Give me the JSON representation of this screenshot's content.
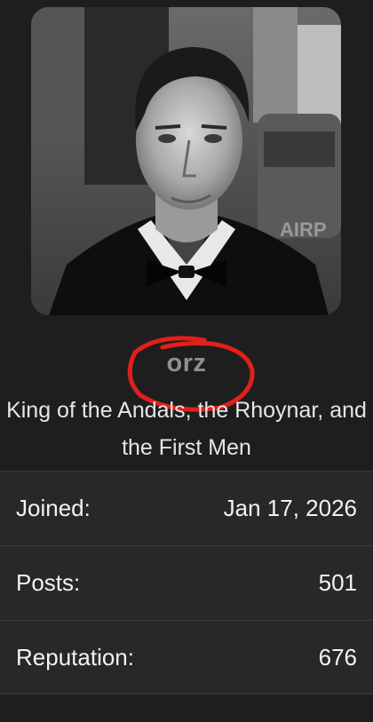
{
  "profile": {
    "username": "orz",
    "user_title": "King of the Andals, the Rhoynar, and the First Men",
    "avatar_alt": "avatar"
  },
  "stats": [
    {
      "label": "Joined:",
      "value": "Jan 17, 2026"
    },
    {
      "label": "Posts:",
      "value": "501"
    },
    {
      "label": "Reputation:",
      "value": "676"
    }
  ],
  "colors": {
    "background": "#1e1e1f",
    "row_background": "#28282a",
    "username": "#8e8e93",
    "text": "#f2f2f4",
    "annotation_red": "#e0201b"
  }
}
